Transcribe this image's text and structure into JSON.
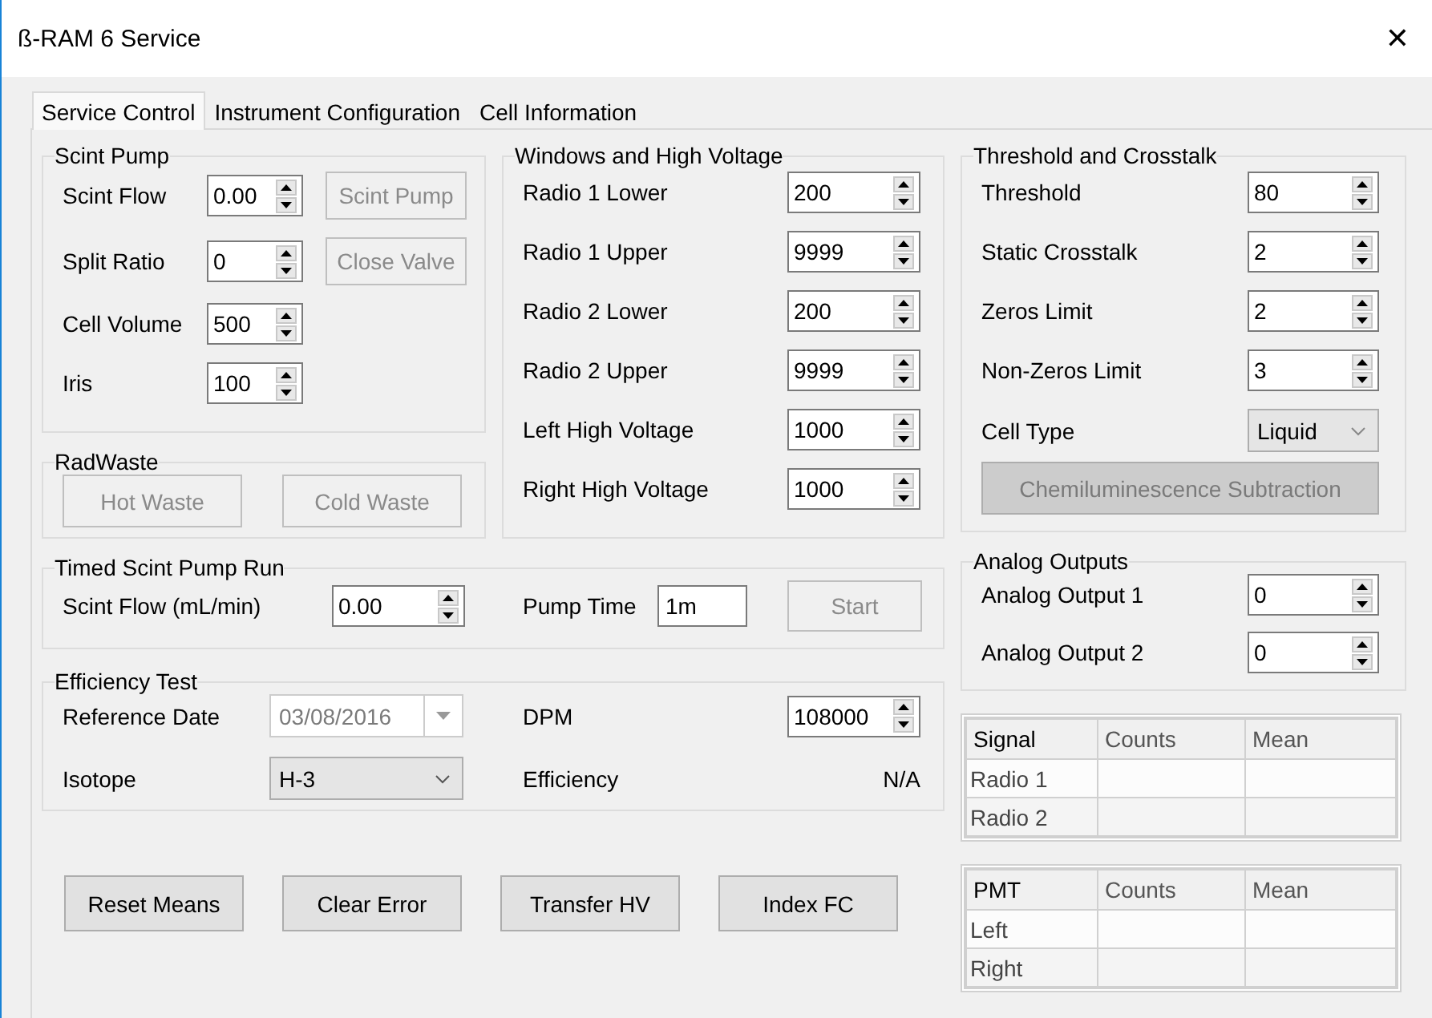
{
  "window": {
    "title": "ß-RAM 6 Service",
    "close": "✕"
  },
  "tabs": [
    {
      "label": "Service Control",
      "selected": true
    },
    {
      "label": "Instrument Configuration",
      "selected": false
    },
    {
      "label": "Cell Information",
      "selected": false
    }
  ],
  "scint_pump": {
    "title": "Scint Pump",
    "fields": [
      {
        "label": "Scint Flow",
        "value": "0.00"
      },
      {
        "label": "Split Ratio",
        "value": "0"
      },
      {
        "label": "Cell Volume",
        "value": "500"
      },
      {
        "label": "Iris",
        "value": "100"
      }
    ],
    "buttons": [
      {
        "label": "Scint Pump",
        "disabled": true
      },
      {
        "label": "Close Valve",
        "disabled": true
      }
    ]
  },
  "radwaste": {
    "title": "RadWaste",
    "buttons": [
      {
        "label": "Hot Waste",
        "disabled": true
      },
      {
        "label": "Cold Waste",
        "disabled": true
      }
    ]
  },
  "windows_hv": {
    "title": "Windows and High Voltage",
    "fields": [
      {
        "label": "Radio 1 Lower",
        "value": "200"
      },
      {
        "label": "Radio 1 Upper",
        "value": "9999"
      },
      {
        "label": "Radio 2 Lower",
        "value": "200"
      },
      {
        "label": "Radio 2 Upper",
        "value": "9999"
      },
      {
        "label": "Left High Voltage",
        "value": "1000"
      },
      {
        "label": "Right High Voltage",
        "value": "1000"
      }
    ]
  },
  "threshold": {
    "title": "Threshold and Crosstalk",
    "fields": [
      {
        "label": "Threshold",
        "value": "80"
      },
      {
        "label": "Static Crosstalk",
        "value": "2"
      },
      {
        "label": "Zeros Limit",
        "value": "2"
      },
      {
        "label": "Non-Zeros Limit",
        "value": "3"
      }
    ],
    "cell_type": {
      "label": "Cell Type",
      "value": "Liquid"
    },
    "button": {
      "label": "Chemiluminescence Subtraction",
      "disabled": true
    }
  },
  "timed_run": {
    "title": "Timed Scint Pump Run",
    "flow": {
      "label": "Scint Flow (mL/min)",
      "value": "0.00"
    },
    "pump_time": {
      "label": "Pump Time",
      "value": "1m"
    },
    "button": {
      "label": "Start",
      "disabled": true
    }
  },
  "efficiency": {
    "title": "Efficiency Test",
    "reference_date": {
      "label": "Reference Date",
      "value": "03/08/2016",
      "disabled": true
    },
    "dpm": {
      "label": "DPM",
      "value": "108000"
    },
    "isotope": {
      "label": "Isotope",
      "value": "H-3"
    },
    "efficiency": {
      "label": "Efficiency",
      "value": "N/A"
    }
  },
  "actions": [
    {
      "label": "Reset Means",
      "disabled": false
    },
    {
      "label": "Clear Error",
      "disabled": false
    },
    {
      "label": "Transfer HV",
      "disabled": false
    },
    {
      "label": "Index FC",
      "disabled": false
    }
  ],
  "analog": {
    "title": "Analog Outputs",
    "fields": [
      {
        "label": "Analog Output 1",
        "value": "0"
      },
      {
        "label": "Analog Output 2",
        "value": "0"
      }
    ]
  },
  "tables": [
    {
      "columns": [
        "Signal",
        "Counts",
        "Mean"
      ],
      "rows": [
        [
          "Radio 1"
        ],
        [
          "Radio 2"
        ]
      ]
    },
    {
      "columns": [
        "PMT",
        "Counts",
        "Mean"
      ],
      "rows": [
        [
          "Left"
        ],
        [
          "Right"
        ]
      ]
    }
  ]
}
